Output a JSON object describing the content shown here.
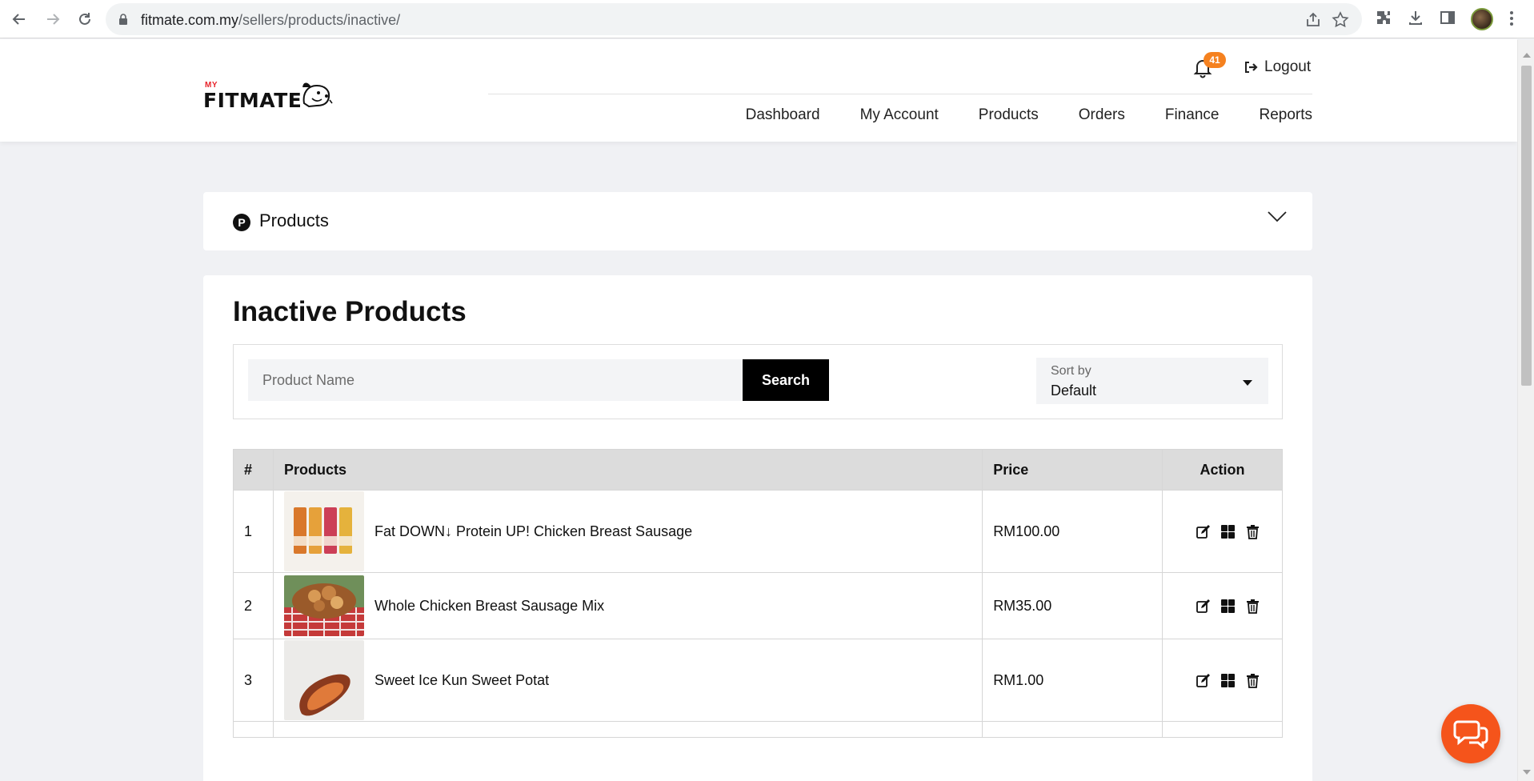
{
  "browser": {
    "url_host": "fitmate.com.my",
    "url_path": "/sellers/products/inactive/"
  },
  "header": {
    "logo_my": "MY",
    "logo_text": "FITMATE",
    "notification_count": "41",
    "logout_label": "Logout",
    "nav": [
      "Dashboard",
      "My Account",
      "Products",
      "Orders",
      "Finance",
      "Reports"
    ]
  },
  "products_panel": {
    "icon_letter": "P",
    "title": "Products"
  },
  "main": {
    "title": "Inactive Products",
    "search": {
      "placeholder": "Product Name",
      "value": "",
      "button_label": "Search"
    },
    "sort": {
      "label": "Sort by",
      "value": "Default"
    },
    "table": {
      "headers": [
        "#",
        "Products",
        "Price",
        "Action"
      ],
      "rows": [
        {
          "num": "1",
          "name": "Fat DOWN↓ Protein UP! Chicken Breast Sausage",
          "price": "RM100.00"
        },
        {
          "num": "2",
          "name": "Whole Chicken Breast Sausage Mix",
          "price": "RM35.00"
        },
        {
          "num": "3",
          "name": "Sweet Ice Kun Sweet Potat",
          "price": "RM1.00"
        }
      ]
    }
  },
  "colors": {
    "accent_orange": "#f5811f",
    "chat_orange": "#f5541b",
    "search_button": "#000000",
    "table_header_bg": "#dcdcdc",
    "page_bg": "#f0f1f4"
  }
}
